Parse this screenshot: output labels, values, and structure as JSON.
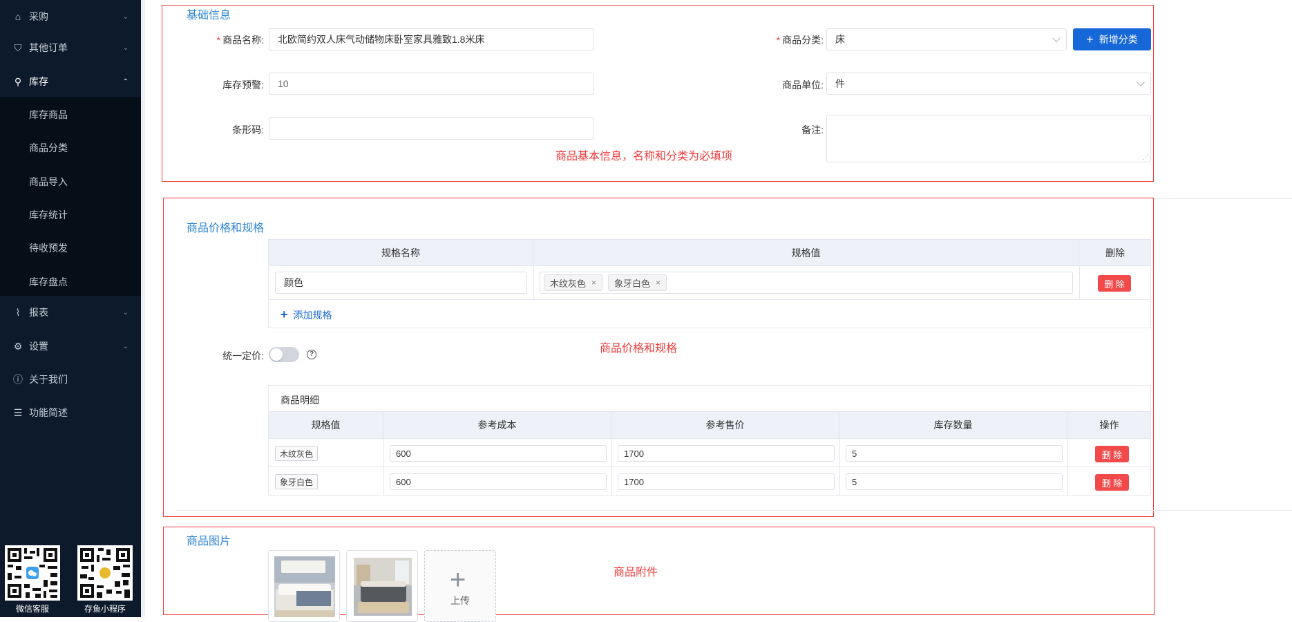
{
  "sidebar": {
    "items": [
      {
        "label": "采购",
        "icon": "shopping-bag-icon",
        "glyph": "⌂",
        "chevron": "⌄"
      },
      {
        "label": "其他订单",
        "icon": "tag-icon",
        "glyph": "⛉",
        "chevron": "⌄"
      },
      {
        "label": "库存",
        "icon": "cart-icon",
        "glyph": "⚲",
        "chevron": "⌃"
      },
      {
        "label": "报表",
        "icon": "chart-icon",
        "glyph": "⌇",
        "chevron": "⌄"
      },
      {
        "label": "设置",
        "icon": "gear-icon",
        "glyph": "⚙",
        "chevron": "⌄"
      },
      {
        "label": "关于我们",
        "icon": "info-icon",
        "glyph": "ⓘ",
        "chevron": ""
      },
      {
        "label": "功能简述",
        "icon": "list-icon",
        "glyph": "☰",
        "chevron": ""
      }
    ],
    "submenu": [
      "库存商品",
      "商品分类",
      "商品导入",
      "库存统计",
      "待收预发",
      "库存盘点"
    ],
    "qr": [
      {
        "label": "微信客服",
        "badge_color": "#3aa0f0"
      },
      {
        "label": "存鱼小程序",
        "badge_color": "#e8b92c"
      }
    ]
  },
  "basic": {
    "title": "基础信息",
    "name_label": "商品名称:",
    "name_value": "北欧简约双人床气动储物床卧室家具雅致1.8米床",
    "category_label": "商品分类:",
    "category_value": "床",
    "new_category_button": "新增分类",
    "stock_warning_label": "库存预警:",
    "stock_warning_value": "10",
    "unit_label": "商品单位:",
    "unit_value": "件",
    "barcode_label": "条形码:",
    "barcode_value": "",
    "remark_label": "备注:",
    "remark_value": "",
    "note": "商品基本信息，名称和分类为必填项"
  },
  "spec": {
    "title": "商品价格和规格",
    "headers": [
      "规格名称",
      "规格值",
      "删除"
    ],
    "row": {
      "name": "颜色",
      "values": [
        "木纹灰色",
        "象牙白色"
      ],
      "delete": "删 除"
    },
    "add_label": "添加规格",
    "note": "商品价格和规格",
    "unified_price_label": "统一定价:",
    "unified_price_on": false
  },
  "detail": {
    "title": "商品明细",
    "headers": [
      "规格值",
      "参考成本",
      "参考售价",
      "库存数量",
      "操作"
    ],
    "rows": [
      {
        "spec": "木纹灰色",
        "cost": "600",
        "price": "1700",
        "qty": "5",
        "action": "删 除"
      },
      {
        "spec": "象牙白色",
        "cost": "600",
        "price": "1700",
        "qty": "5",
        "action": "删 除"
      }
    ]
  },
  "images": {
    "title": "商品图片",
    "upload_label": "上传",
    "note": "商品附件"
  },
  "colors": {
    "accent": "#1667d8",
    "danger": "#f24a4a",
    "annotation": "#f03a3a",
    "sidebar_bg": "#0c1a2b"
  }
}
